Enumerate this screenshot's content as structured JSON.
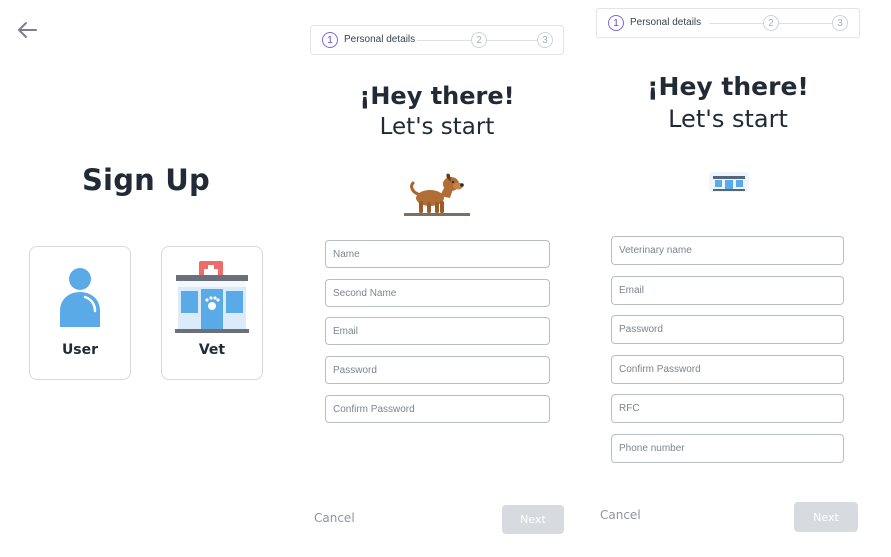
{
  "signup_screen": {
    "title": "Sign Up",
    "options": [
      {
        "label": "User",
        "icon": "user-icon"
      },
      {
        "label": "Vet",
        "icon": "vet-clinic-icon"
      }
    ]
  },
  "user_form": {
    "stepper": {
      "steps": [
        "1",
        "2",
        "3"
      ],
      "active_label": "Personal details"
    },
    "greeting": "¡Hey there!",
    "subtitle": "Let's start",
    "illustration": "dog-icon",
    "fields": [
      {
        "placeholder": "Name"
      },
      {
        "placeholder": "Second Name"
      },
      {
        "placeholder": "Email"
      },
      {
        "placeholder": "Password"
      },
      {
        "placeholder": "Confirm Password"
      }
    ],
    "cancel_label": "Cancel",
    "next_label": "Next"
  },
  "vet_form": {
    "stepper": {
      "steps": [
        "1",
        "2",
        "3"
      ],
      "active_label": "Personal details"
    },
    "greeting": "¡Hey there!",
    "subtitle": "Let's start",
    "illustration": "clinic-icon",
    "fields": [
      {
        "placeholder": "Veterinary name"
      },
      {
        "placeholder": "Email"
      },
      {
        "placeholder": "Password"
      },
      {
        "placeholder": "Confirm Password"
      },
      {
        "placeholder": "RFC"
      },
      {
        "placeholder": "Phone number"
      }
    ],
    "cancel_label": "Cancel",
    "next_label": "Next"
  },
  "colors": {
    "accent": "#7b6ad6",
    "user_icon_blue": "#5aaae8",
    "vet_red": "#ee6b6b",
    "dog_brown": "#a7652d",
    "button_disabled": "#d7dadf"
  }
}
